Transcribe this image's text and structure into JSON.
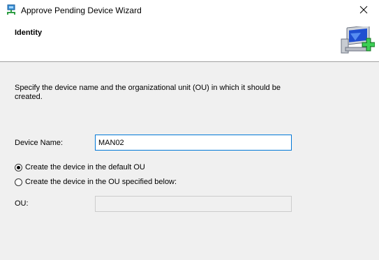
{
  "window": {
    "title": "Approve Pending Device Wizard",
    "close_icon": "close-icon",
    "app_icon": "network-device-icon"
  },
  "header": {
    "title": "Identity",
    "graphic_icon": "computer-add-icon"
  },
  "body": {
    "description": "Specify the device name and the organizational unit (OU) in which it should be created.",
    "device_name_label": "Device Name:",
    "device_name_value": "MAN02",
    "radio_default_label": "Create the device in the default OU",
    "radio_default_checked": true,
    "radio_specified_label": "Create the device in the OU specified below:",
    "radio_specified_checked": false,
    "ou_label": "OU:",
    "ou_value": ""
  },
  "colors": {
    "accent": "#0078d7",
    "background": "#f0f0f0",
    "header_background": "#ffffff"
  }
}
